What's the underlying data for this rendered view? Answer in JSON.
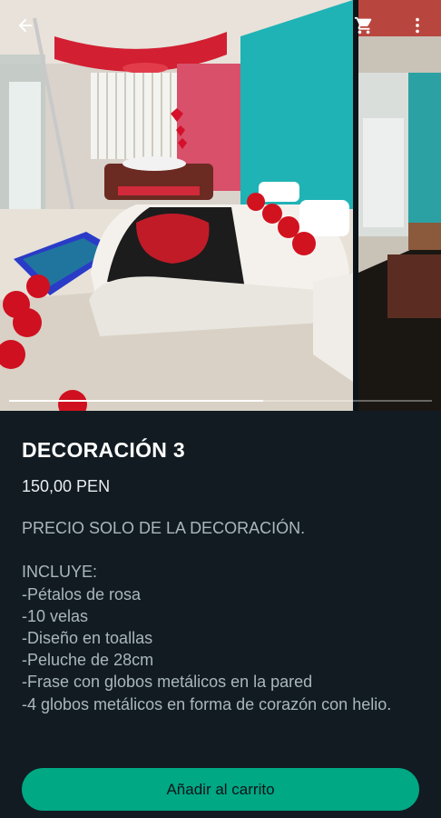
{
  "gallery": {
    "progress": 0.6,
    "progress_color": "#ffffff"
  },
  "product": {
    "title": "DECORACIÓN 3",
    "price": "150,00 PEN",
    "description_lines": [
      "PRECIO SOLO DE LA DECORACIÓN.",
      "",
      "INCLUYE:",
      "-Pétalos de rosa",
      "-10 velas",
      "-Diseño en toallas",
      "-Peluche de 28cm",
      "-Frase con globos metálicos en la pared",
      "-4 globos metálicos en forma de corazón con helio."
    ]
  },
  "icons": {
    "back": "arrow-left-icon",
    "cart": "cart-icon",
    "more": "more-vertical-icon"
  },
  "actions": {
    "add_to_cart": "Añadir al carrito"
  },
  "colors": {
    "background": "#121b22",
    "accent": "#00a884"
  }
}
